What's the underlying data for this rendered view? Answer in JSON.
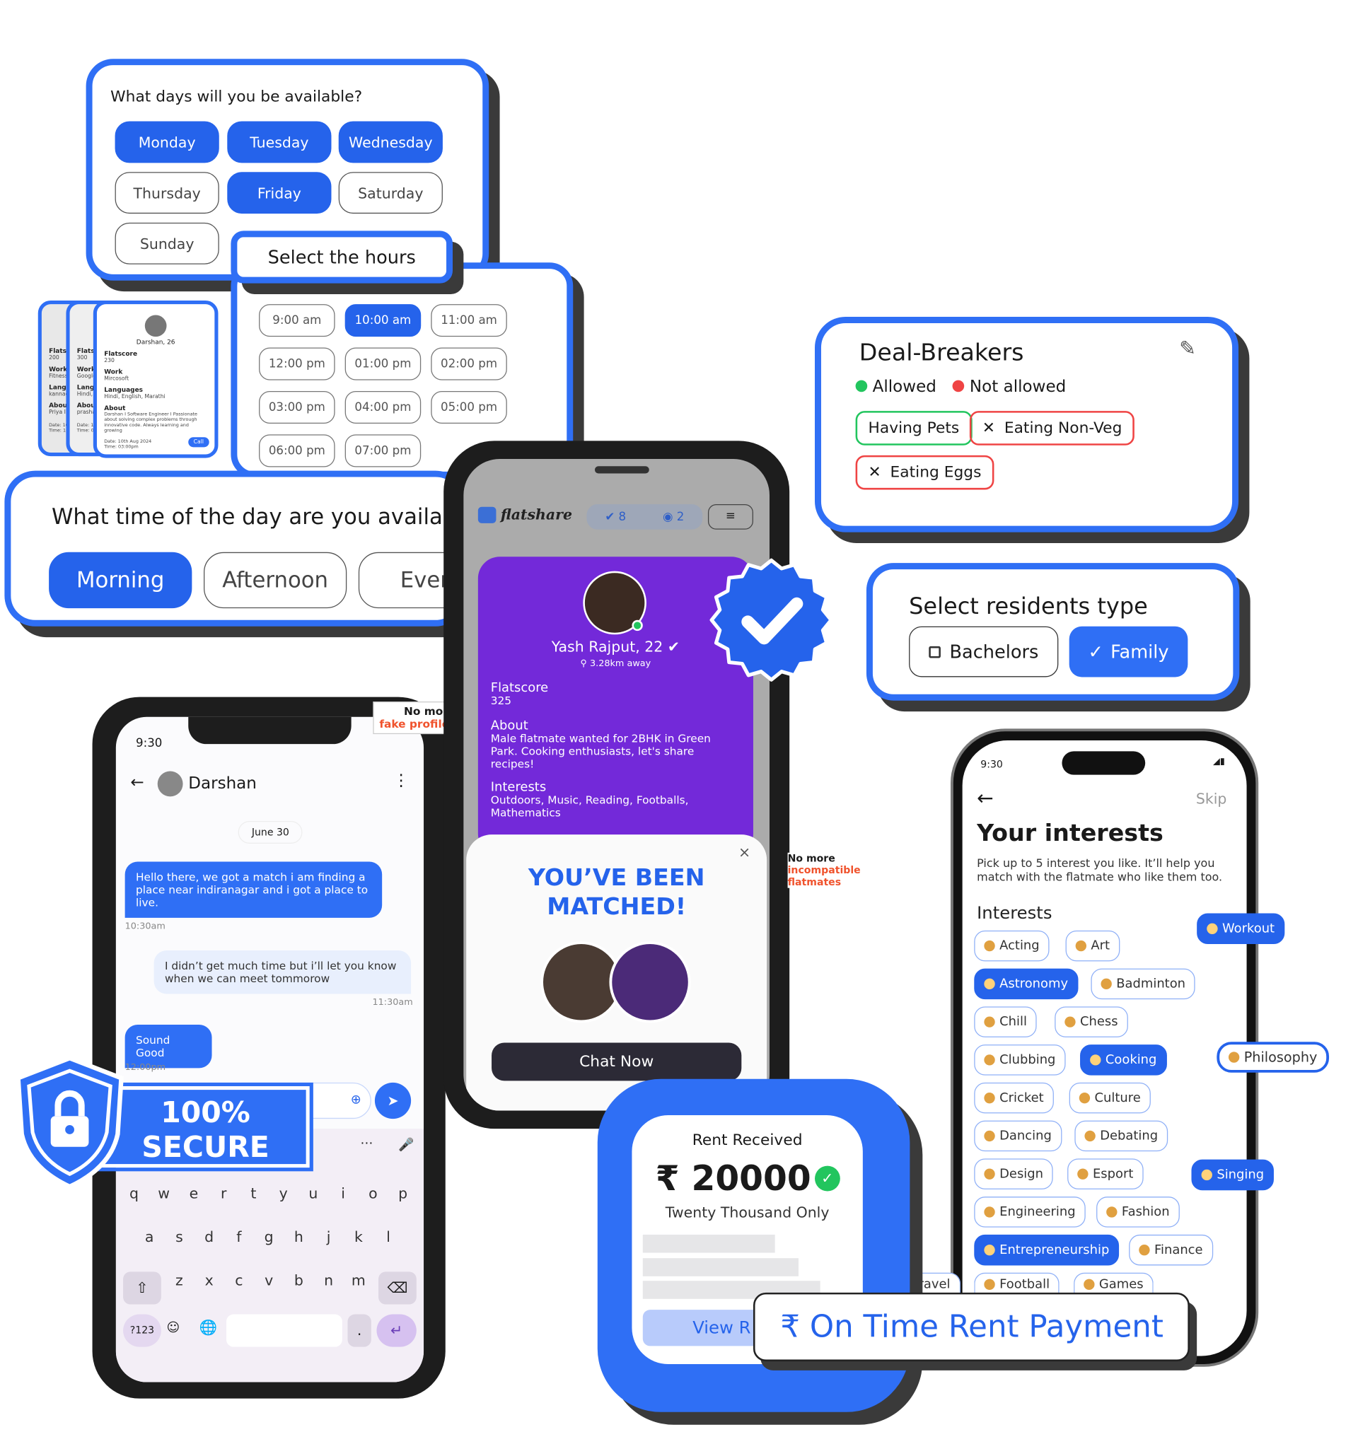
{
  "days_card": {
    "title": "What days will you be available?",
    "days": [
      {
        "label": "Monday",
        "selected": true
      },
      {
        "label": "Tuesday",
        "selected": true
      },
      {
        "label": "Wednesday",
        "selected": true
      },
      {
        "label": "Thursday",
        "selected": false
      },
      {
        "label": "Friday",
        "selected": true
      },
      {
        "label": "Saturday",
        "selected": false
      },
      {
        "label": "Sunday",
        "selected": false
      }
    ]
  },
  "hours_card": {
    "title": "Select the hours",
    "hours": [
      {
        "label": "9:00 am",
        "selected": false
      },
      {
        "label": "10:00 am",
        "selected": true
      },
      {
        "label": "11:00 am",
        "selected": false
      },
      {
        "label": "12:00 pm",
        "selected": false
      },
      {
        "label": "01:00 pm",
        "selected": false
      },
      {
        "label": "02:00 pm",
        "selected": false
      },
      {
        "label": "03:00 pm",
        "selected": false
      },
      {
        "label": "04:00 pm",
        "selected": false
      },
      {
        "label": "05:00 pm",
        "selected": false
      },
      {
        "label": "06:00 pm",
        "selected": false
      },
      {
        "label": "07:00 pm",
        "selected": false
      }
    ]
  },
  "profile_cards": {
    "back": [
      {
        "flatscore_label": "Flatsco",
        "flatscore": "200",
        "work_label": "Work",
        "work": "Fitness",
        "lang_label": "Langua",
        "lang": "kannada",
        "about_label": "About",
        "about": "Priya I Se solving health. A",
        "date": "Date: 10th",
        "time": "Time: 10:00"
      },
      {
        "flatscore_label": "Flatsco",
        "flatscore": "300",
        "work_label": "Work",
        "work": "Google",
        "lang_label": "Langua",
        "lang": "Hindi, E",
        "about_label": "About",
        "about": "prashan about s innovat",
        "date": "Date: 10th",
        "time": "Time: 03:0"
      }
    ],
    "front": {
      "name": "Darshan, 26",
      "flatscore_label": "Flatscore",
      "flatscore": "230",
      "work_label": "Work",
      "work": "Mircosoft",
      "lang_label": "Languages",
      "lang": "Hindi, English, Marathi",
      "about_label": "About",
      "about": "Darshan I Software Engineer I Passionate about solving complex problems through innovative code. Always learning and growing",
      "date": "Date: 10th Aug 2024",
      "time": "Time: 03:00pm",
      "call_label": "Call"
    }
  },
  "time_of_day_card": {
    "title": "What time of the day are you availab",
    "options": [
      {
        "label": "Morning",
        "selected": true
      },
      {
        "label": "Afternoon",
        "selected": false
      },
      {
        "label": "Eveni",
        "selected": false
      }
    ]
  },
  "match_phone": {
    "logo": "flatshare",
    "likes": "8",
    "chats": "2",
    "profile": {
      "name": "Yash Rajput, 22",
      "distance": "3.28km away",
      "flatscore_label": "Flatscore",
      "flatscore": "325",
      "about_label": "About",
      "about": "Male flatmate wanted for 2BHK in Green Park. Cooking enthusiasts, let's share recipes!",
      "interests_label": "Interests",
      "interests": "Outdoors, Music, Reading, Footballs, Mathematics"
    },
    "modal": {
      "title_line1": "YOU’VE BEEN",
      "title_line2": "MATCHED!",
      "close": "×",
      "cta": "Chat Now"
    }
  },
  "deal_breakers": {
    "title": "Deal-Breakers",
    "legend_allowed": "Allowed",
    "legend_not_allowed": "Not allowed",
    "items": [
      {
        "label": "Having Pets",
        "allowed": true
      },
      {
        "label": "Eating Non-Veg",
        "allowed": false
      },
      {
        "label": "Eating Eggs",
        "allowed": false
      }
    ],
    "colors": {
      "allowed": "#22c55e",
      "not_allowed": "#ef4444"
    }
  },
  "residents_card": {
    "title": "Select residents type",
    "options": [
      {
        "label": "Bachelors",
        "selected": false
      },
      {
        "label": "Family",
        "selected": true
      }
    ]
  },
  "chat_phone": {
    "time": "9:30",
    "contact": "Darshan",
    "date_chip": "June 30",
    "messages": [
      {
        "text": "Hello there, we got a match i am finding a place near indiranagar and i got a place to live.",
        "time": "10:30am",
        "mine": true
      },
      {
        "text": "I didn’t get much time but i’ll let you know when we can meet tommorow",
        "time": "11:30am",
        "mine": false
      },
      {
        "text": "Sound Good",
        "time": "12:00pm",
        "mine": true
      }
    ],
    "keyboard": {
      "row1": [
        "q",
        "w",
        "e",
        "r",
        "t",
        "y",
        "u",
        "i",
        "o",
        "p"
      ],
      "row2": [
        "a",
        "s",
        "d",
        "f",
        "g",
        "h",
        "j",
        "k",
        "l"
      ],
      "row3": [
        "z",
        "x",
        "c",
        "v",
        "b",
        "n",
        "m"
      ],
      "sym": "?123",
      "dot": "."
    }
  },
  "tags": {
    "fake_line1": "No more",
    "fake_line2": "fake profiles",
    "incompat_line1": "No more",
    "incompat_line2": "incompatible",
    "incompat_line3": "flatmates"
  },
  "secure_badge": {
    "line1": "100%",
    "line2": "SECURE"
  },
  "interests_phone": {
    "time": "9:30",
    "skip": "Skip",
    "title": "Your interests",
    "subtitle": "Pick up to 5 interest you like. It’ll help you match with the flatmate who like them too.",
    "section": "Interests",
    "chips": [
      {
        "label": "Acting",
        "icon": "performing-arts-icon",
        "selected": false
      },
      {
        "label": "Art",
        "icon": "palette-icon",
        "selected": false
      },
      {
        "label": "Astronomy",
        "icon": "planet-icon",
        "selected": true
      },
      {
        "label": "Badminton",
        "icon": "badminton-icon",
        "selected": false
      },
      {
        "label": "Chill",
        "icon": "maple-leaf-icon",
        "selected": false
      },
      {
        "label": "Chess",
        "icon": "chess-pawn-icon",
        "selected": false
      },
      {
        "label": "Clubbing",
        "icon": "beer-icon",
        "selected": false
      },
      {
        "label": "Cooking",
        "icon": "fork-knife-icon",
        "selected": true
      },
      {
        "label": "Cricket",
        "icon": "cricket-icon",
        "selected": false
      },
      {
        "label": "Culture",
        "icon": "globe-icon",
        "selected": false
      },
      {
        "label": "Dancing",
        "icon": "dancer-icon",
        "selected": false
      },
      {
        "label": "Debating",
        "icon": "speaking-head-icon",
        "selected": false
      },
      {
        "label": "Design",
        "icon": "artist-icon",
        "selected": false
      },
      {
        "label": "Esport",
        "icon": "gamepad-icon",
        "selected": false
      },
      {
        "label": "Engineering",
        "icon": "tools-icon",
        "selected": false
      },
      {
        "label": "Fashion",
        "icon": "dress-icon",
        "selected": false
      },
      {
        "label": "Entrepreneurship",
        "icon": "lightbulb-icon",
        "selected": true
      },
      {
        "label": "Finance",
        "icon": "coin-icon",
        "selected": false
      },
      {
        "label": "Travel",
        "icon": "airplane-icon",
        "selected": false
      },
      {
        "label": "Football",
        "icon": "soccer-ball-icon",
        "selected": false
      },
      {
        "label": "Games",
        "icon": "dice-icon",
        "selected": false
      }
    ],
    "floating": [
      {
        "label": "Workout",
        "icon": "weightlifter-icon",
        "selected": true
      },
      {
        "label": "Philosophy",
        "icon": "brain-icon",
        "selected": false
      },
      {
        "label": "Singing",
        "icon": "microphone-icon",
        "selected": true
      }
    ]
  },
  "rent_card": {
    "title": "Rent Received",
    "amount": "₹ 20000",
    "amount_words": "Twenty Thousand Only",
    "button": "View R"
  },
  "rent_banner": {
    "text": "₹ On Time Rent Payment"
  },
  "colors": {
    "primary": "#2563eb",
    "purple": "#7329d9",
    "shadow": "#3a3a3a"
  }
}
